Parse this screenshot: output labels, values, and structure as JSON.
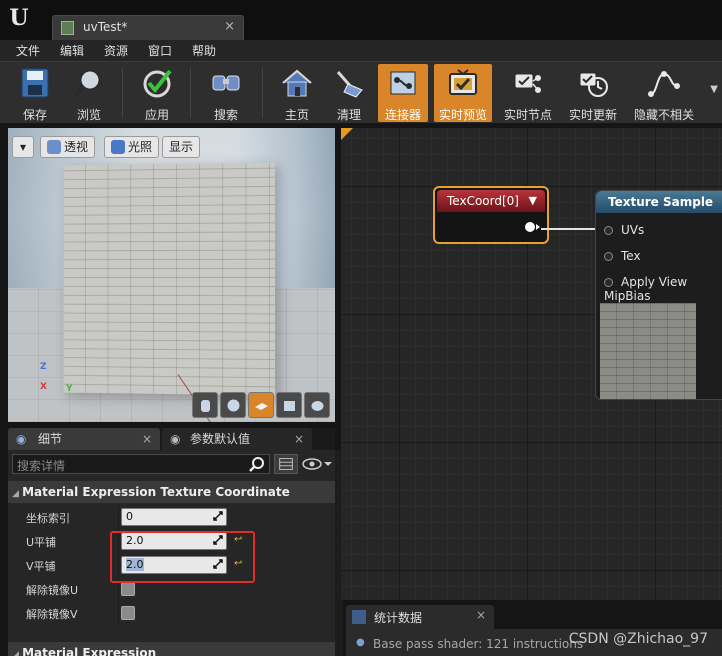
{
  "window": {
    "tab_title": "uvTest*",
    "tab_close": "×"
  },
  "menu": [
    "文件",
    "编辑",
    "资源",
    "窗口",
    "帮助"
  ],
  "toolbar": {
    "buttons": [
      {
        "label": "保存",
        "icon": "save-icon"
      },
      {
        "label": "浏览",
        "icon": "browse-icon"
      },
      {
        "label": "应用",
        "icon": "apply-icon"
      },
      {
        "label": "搜索",
        "icon": "search-icon"
      },
      {
        "label": "主页",
        "icon": "home-icon"
      },
      {
        "label": "清理",
        "icon": "clean-icon"
      },
      {
        "label": "连接器",
        "icon": "connector-icon",
        "active": true
      },
      {
        "label": "实时预览",
        "icon": "live-preview-icon",
        "active": true
      },
      {
        "label": "实时节点",
        "icon": "live-nodes-icon"
      },
      {
        "label": "实时更新",
        "icon": "live-update-icon"
      },
      {
        "label": "隐藏不相关",
        "icon": "hide-unrelated-icon"
      }
    ],
    "more": "▼"
  },
  "viewport": {
    "dropdown": "▾",
    "perspective_label": "透视",
    "lit_label": "光照",
    "show_label": "显示",
    "axis_z": "Z",
    "axis_x": "X",
    "axis_y": "Y"
  },
  "panels": {
    "details_tab": "细节",
    "params_tab": "参数默认值",
    "close": "×"
  },
  "details": {
    "search_placeholder": "搜索详情",
    "category1": "Material Expression Texture Coordinate",
    "category2": "Material Expression",
    "properties": [
      {
        "label": "坐标索引",
        "value": "0"
      },
      {
        "label": "U平铺",
        "value": "2.0",
        "resettable": true
      },
      {
        "label": "V平铺",
        "value": "2.0",
        "resettable": true,
        "selected": true
      },
      {
        "label": "解除镜像U",
        "checkbox": true
      },
      {
        "label": "解除镜像V",
        "checkbox": true
      }
    ]
  },
  "graph": {
    "node_texcoord": {
      "title": "TexCoord[0]",
      "menu": "▼"
    },
    "node_texture": {
      "title": "Texture Sample",
      "pins": [
        "UVs",
        "Tex",
        "Apply View MipBias"
      ]
    }
  },
  "stats": {
    "tab_label": "统计数据",
    "close": "×",
    "lines": [
      "Base pass shader: 121 instructions"
    ]
  },
  "watermark": "CSDN @Zhichao_97",
  "colors": {
    "accent_orange": "#d9862a",
    "node_red": "#b8343a",
    "node_blue": "#4a7a96",
    "highlight_red": "#e52a2a"
  }
}
